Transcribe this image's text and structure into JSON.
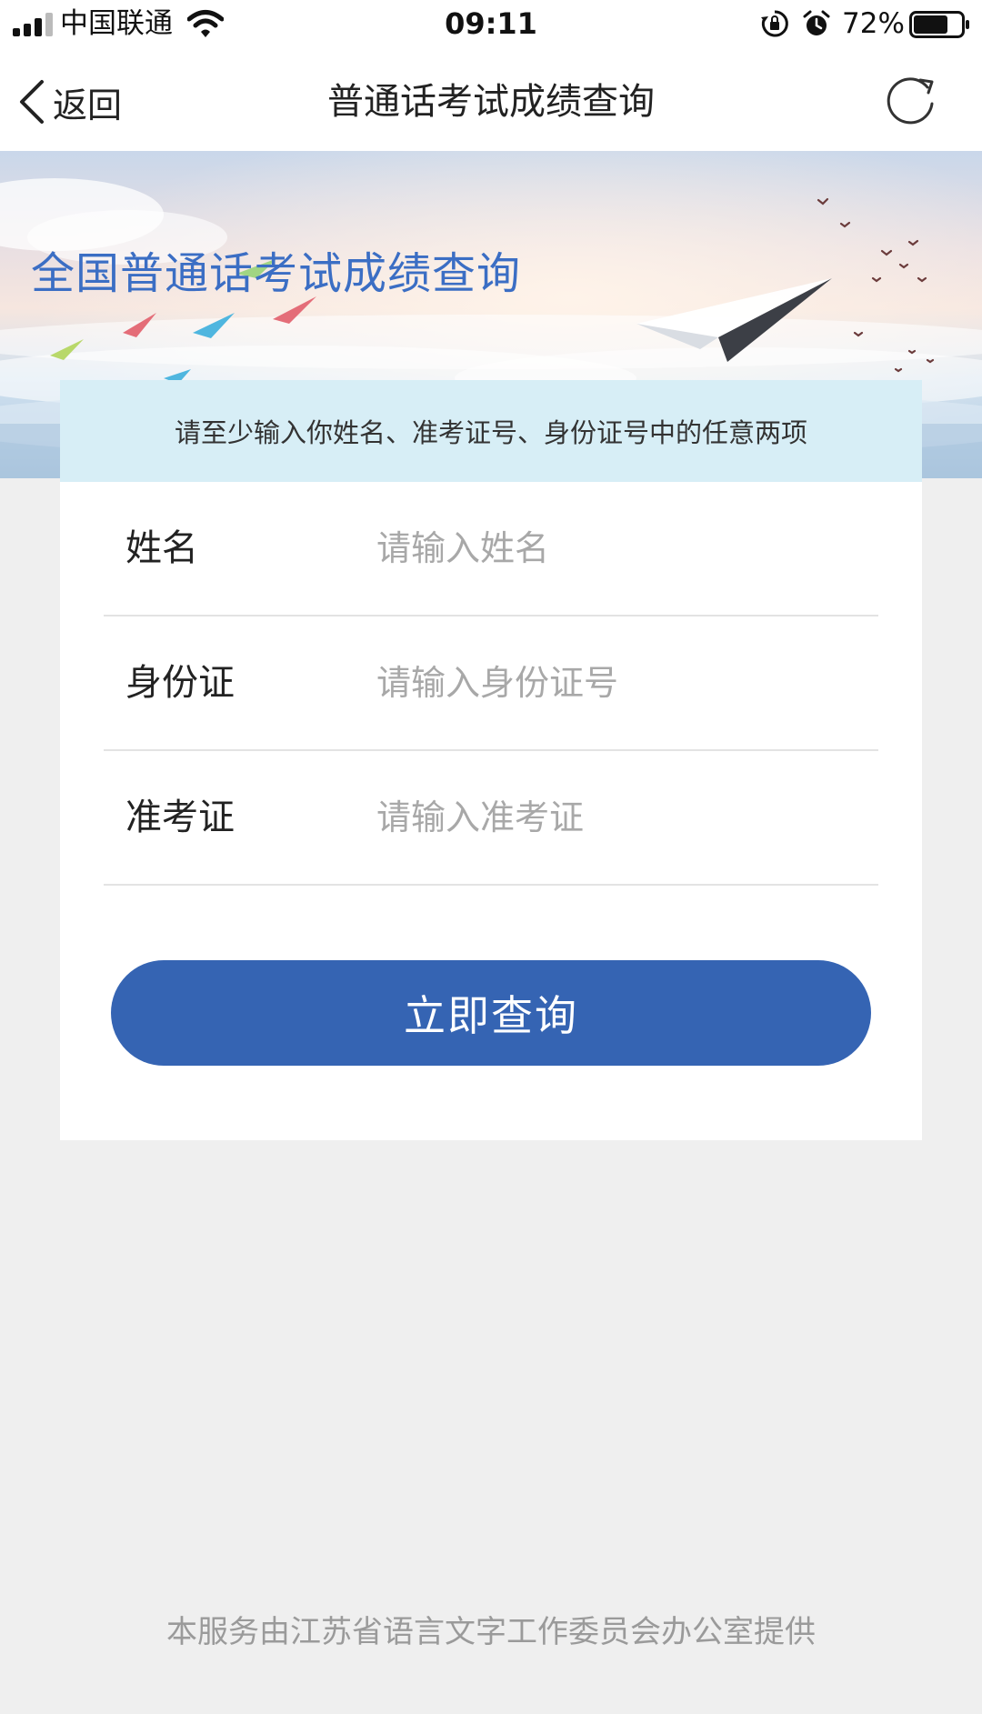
{
  "status_bar": {
    "carrier": "中国联通",
    "time": "09:11",
    "battery_percent": "72%",
    "battery_level": 0.72,
    "icons": [
      "signal-icon",
      "wifi-icon",
      "orientation-lock-icon",
      "alarm-icon",
      "battery-icon"
    ]
  },
  "nav": {
    "back_label": "返回",
    "title": "普通话考试成绩查询",
    "back_icon": "chevron-left-icon",
    "refresh_icon": "refresh-icon"
  },
  "banner": {
    "title": "全国普通话考试成绩查询"
  },
  "form": {
    "notice": "请至少输入你姓名、准考证号、身份证号中的任意两项",
    "fields": [
      {
        "label": "姓名",
        "placeholder": "请输入姓名",
        "value": ""
      },
      {
        "label": "身份证",
        "placeholder": "请输入身份证号",
        "value": ""
      },
      {
        "label": "准考证",
        "placeholder": "请输入准考证",
        "value": ""
      }
    ],
    "submit_label": "立即查询"
  },
  "footer": {
    "text": "本服务由江苏省语言文字工作委员会办公室提供"
  },
  "colors": {
    "accent": "#3564b3",
    "banner_title": "#3b6ec4",
    "notice_bg": "#d7eef6",
    "page_bg": "#efefef"
  }
}
